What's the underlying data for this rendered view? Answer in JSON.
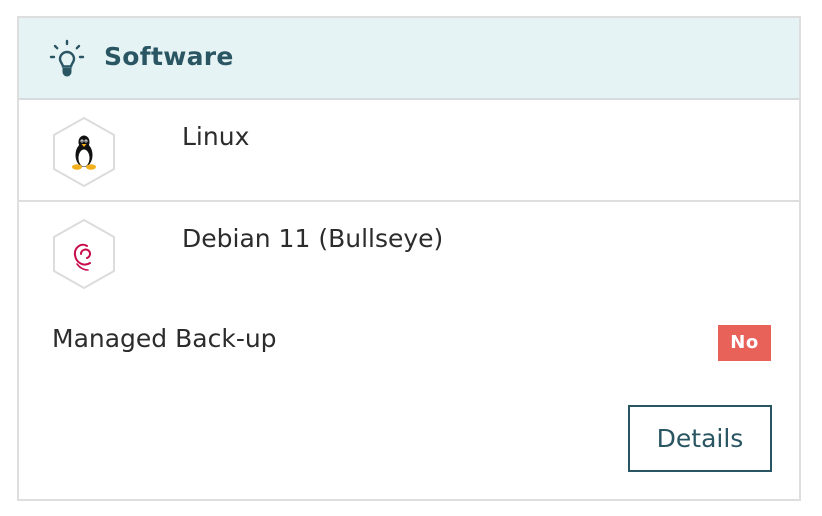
{
  "header": {
    "title": "Software",
    "icon": "lightbulb-icon",
    "background_color": "#e5f3f4",
    "title_color": "#2a5563"
  },
  "software": [
    {
      "name": "Linux",
      "icon": "linux-tux-icon"
    },
    {
      "name": "Debian 11 (Bullseye)",
      "icon": "debian-swirl-icon"
    }
  ],
  "backup": {
    "label": "Managed Back-up",
    "status": "No",
    "status_color": "#e8625a"
  },
  "actions": {
    "details_label": "Details",
    "accent_color": "#2a5563"
  }
}
